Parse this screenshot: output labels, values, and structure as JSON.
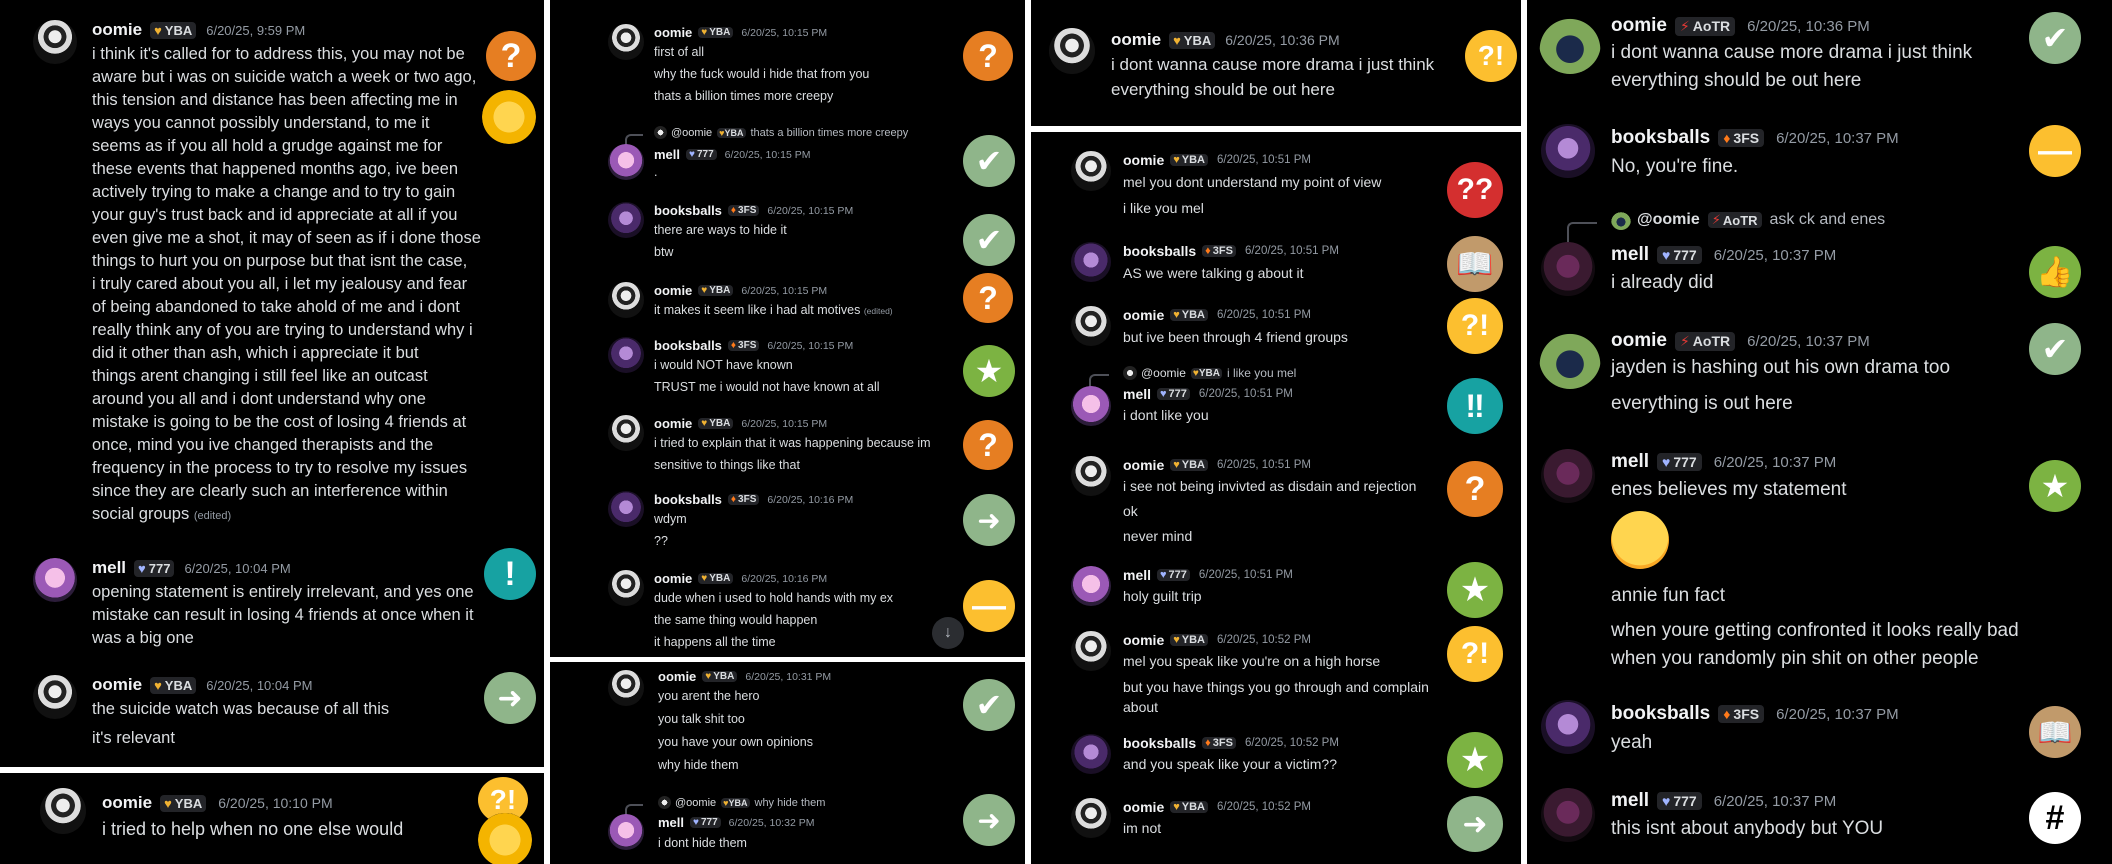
{
  "users": {
    "oomie": {
      "name": "oomie",
      "tag": "YBA"
    },
    "mell": {
      "name": "mell",
      "tag": "777"
    },
    "booksballs": {
      "name": "booksballs",
      "tag": "3FS"
    },
    "oomie2": {
      "name": "oomie",
      "tag": "AoTR"
    }
  },
  "edited_label": "(edited)",
  "colors": {
    "background": "#000000",
    "name": "#f2f3f5",
    "text": "#dbdee1",
    "muted": "#949ba4",
    "orange": "#e67e22",
    "green": "#7cb342",
    "teal": "#17a2a2",
    "red": "#d42f2f",
    "yellow": "#fcbf2f"
  },
  "panel1": {
    "m1": {
      "time": "6/20/25, 9:59 PM",
      "lines": [
        "i think it's called for to address this, you may not be",
        "aware but i was on suicide watch a week or two ago,",
        "this tension and distance has been affecting me in",
        "ways you cannot possibly understand, to me it",
        "seems as if you all hold a grudge against me for",
        "these events that happened months ago, ive been",
        "actively trying to make a change and to try to gain",
        "your guy's trust back and id appreciate at all if you",
        "even give me a shot, it may of seen as if i done those",
        "things to hurt you on purpose but that isnt the case,",
        "i truly cared about you all, i let my jealousy and fear",
        "of being abandoned to take ahold of me and i dont",
        "really think any of you are trying to understand why i",
        "did it other than ash, which i appreciate it but",
        "things arent changing i still feel like an outcast",
        "around you all and i dont understand why one",
        "mistake is going to be the cost of losing 4 friends at",
        "once, mind you ive changed therapists and the",
        "frequency in the process to try to resolve my issues",
        "since they are clearly such an interference within",
        "social groups"
      ]
    },
    "m2": {
      "time": "6/20/25, 10:04 PM",
      "lines": [
        "opening statement is entirely irrelevant, and yes one",
        "mistake can result in losing 4 friends at once when it",
        "was a big one"
      ]
    },
    "m3": {
      "time": "6/20/25, 10:04 PM",
      "lines": [
        "the suicide watch was because of all this",
        "it's relevant"
      ]
    }
  },
  "panel2": {
    "m1": {
      "time": "6/20/25, 10:10 PM",
      "lines": [
        "i tried to help when no one else would"
      ]
    }
  },
  "panel3": {
    "m1": {
      "time": "6/20/25, 10:15 PM",
      "lines": [
        "first of all",
        "why the fuck would i hide that from you",
        "thats a billion times more creepy"
      ]
    },
    "m2": {
      "reply_text": "thats a billion times more creepy",
      "reply_user": "@oomie",
      "time": "6/20/25, 10:15 PM",
      "lines": [
        "."
      ]
    },
    "m3": {
      "time": "6/20/25, 10:15 PM",
      "lines": [
        "there are ways to hide it",
        "btw"
      ]
    },
    "m4": {
      "time": "6/20/25, 10:15 PM",
      "lines": [
        "it makes it seem like i had alt motives"
      ]
    },
    "m5": {
      "time": "6/20/25, 10:15 PM",
      "lines": [
        "i would NOT have known",
        "TRUST me i would not have known at all"
      ]
    },
    "m6": {
      "time": "6/20/25, 10:15 PM",
      "lines": [
        "i tried to explain that it was happening because im",
        "sensitive to things like that"
      ]
    },
    "m7": {
      "time": "6/20/25, 10:16 PM",
      "lines": [
        "wdym",
        "??"
      ]
    },
    "m8": {
      "time": "6/20/25, 10:16 PM",
      "lines": [
        "dude when i used to hold hands with my ex",
        "the same thing would happen",
        "it happens all the time"
      ]
    }
  },
  "panel4": {
    "m1": {
      "time": "6/20/25, 10:31 PM",
      "lines": [
        "you arent the hero",
        "you talk shit too",
        "you have your own opinions",
        "why hide them"
      ]
    },
    "m2": {
      "reply_user": "@oomie",
      "reply_text": "why hide them",
      "time": "6/20/25, 10:32 PM",
      "lines": [
        "i dont hide them"
      ]
    }
  },
  "panel5": {
    "m1": {
      "time": "6/20/25, 10:36 PM",
      "lines": [
        "i dont wanna cause more drama i just think",
        "everything should be out here"
      ]
    }
  },
  "panel6": {
    "m1": {
      "time": "6/20/25, 10:51 PM",
      "lines": [
        "mel you dont understand my point of view",
        "i like you mel"
      ]
    },
    "m2": {
      "time": "6/20/25, 10:51 PM",
      "lines": [
        "AS we were talking g about it"
      ]
    },
    "m3": {
      "time": "6/20/25, 10:51 PM",
      "lines": [
        "but ive been through 4 friend groups"
      ]
    },
    "m4": {
      "reply_user": "@oomie",
      "reply_text": "i like you mel",
      "time": "6/20/25, 10:51 PM",
      "lines": [
        "i dont like you"
      ]
    },
    "m5": {
      "time": "6/20/25, 10:51 PM",
      "lines": [
        "i see not being invivted as disdain and rejection",
        "ok",
        "never mind"
      ]
    },
    "m6": {
      "time": "6/20/25, 10:51 PM",
      "lines": [
        "holy guilt trip"
      ]
    },
    "m7": {
      "time": "6/20/25, 10:52 PM",
      "lines": [
        "mel you speak like you're on a high horse",
        "but you have things you go through and complain",
        "about"
      ]
    },
    "m8": {
      "time": "6/20/25, 10:52 PM",
      "lines": [
        "and you speak like your a victim??"
      ]
    },
    "m9": {
      "time": "6/20/25, 10:52 PM",
      "lines": [
        "im not"
      ]
    }
  },
  "panel7": {
    "m1": {
      "time": "6/20/25, 10:36 PM",
      "lines": [
        "i dont wanna cause more drama i just think",
        "everything should be out here"
      ]
    },
    "m2": {
      "time": "6/20/25, 10:37 PM",
      "lines": [
        "No, you're fine."
      ]
    },
    "m3": {
      "reply_user": "@oomie",
      "reply_text": "ask ck and enes",
      "time": "6/20/25, 10:37 PM",
      "lines": [
        "i already did"
      ]
    },
    "m4": {
      "time": "6/20/25, 10:37 PM",
      "lines": [
        "jayden is hashing out his own drama too",
        "everything is out here"
      ]
    },
    "m5": {
      "time": "6/20/25, 10:37 PM",
      "lines": [
        "enes believes my statement",
        "annie fun fact",
        "when youre getting confronted it looks really bad",
        "when you randomly pin shit on other people"
      ]
    },
    "m6": {
      "time": "6/20/25, 10:37 PM",
      "lines": [
        "yeah"
      ]
    },
    "m7": {
      "time": "6/20/25, 10:37 PM",
      "lines": [
        "this isnt about anybody but YOU"
      ]
    }
  }
}
